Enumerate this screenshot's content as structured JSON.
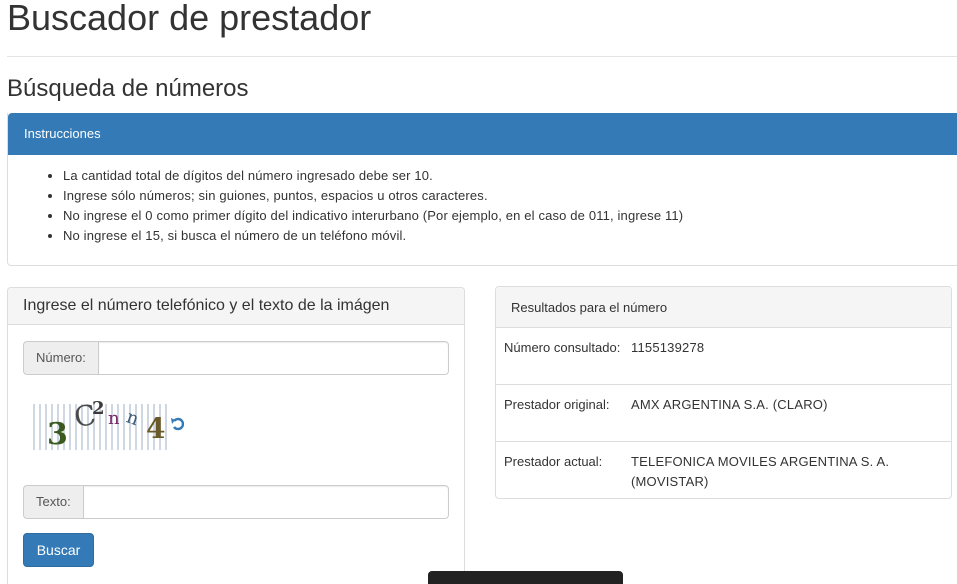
{
  "page": {
    "title": "Buscador de prestador",
    "section_title": "Búsqueda de números"
  },
  "instructions": {
    "heading": "Instrucciones",
    "items": [
      "La cantidad total de dígitos del número ingresado debe ser 10.",
      "Ingrese sólo números; sin guiones, puntos, espacios u otros caracteres.",
      "No ingrese el 0 como primer dígito del indicativo interurbano (Por ejemplo, en el caso de 011, ingrese 11)",
      "No ingrese el 15, si busca el número de un teléfono móvil."
    ]
  },
  "search": {
    "heading": "Ingrese el número telefónico y el texto de la imágen",
    "numero_label": "Número:",
    "numero_value": "",
    "texto_label": "Texto:",
    "texto_value": "",
    "captcha_chars": "3C2nn4",
    "refresh_icon": "refresh-icon",
    "button_label": "Buscar"
  },
  "results": {
    "heading": "Resultados para el número",
    "rows": [
      {
        "label": "Número consultado:",
        "value": "1155139278"
      },
      {
        "label": "Prestador original:",
        "value": "AMX ARGENTINA S.A. (CLARO)"
      },
      {
        "label": "Prestador actual:",
        "value": "TELEFONICA MOVILES ARGENTINA S. A. (MOVISTAR)"
      }
    ]
  },
  "colors": {
    "primary": "#337ab7",
    "panel_border": "#dddddd",
    "panel_heading_bg": "#f5f5f5"
  }
}
